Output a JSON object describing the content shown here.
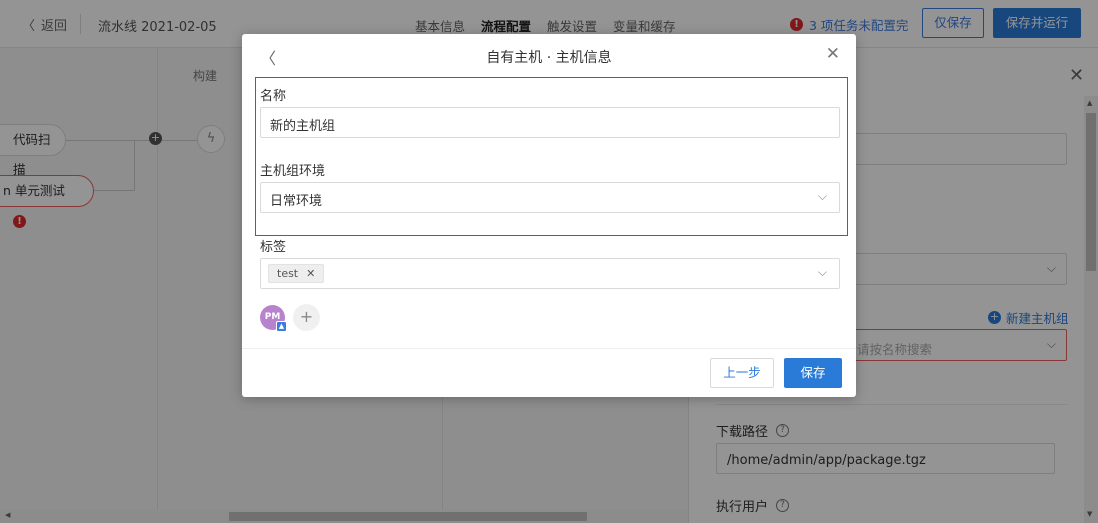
{
  "header": {
    "back_label": "返回",
    "pipeline_title": "流水线 2021-02-05",
    "tabs": [
      "基本信息",
      "流程配置",
      "触发设置",
      "变量和缓存"
    ],
    "warning_text": "3 项任务未配置完",
    "save_only_label": "仅保存",
    "save_run_label": "保存并运行"
  },
  "canvas": {
    "column_label": "构建",
    "nodes": [
      "代码扫描",
      "n 单元测试"
    ]
  },
  "drawer": {
    "new_group_label": "新建主机组",
    "search_placeholder": "请按名称搜索",
    "download_path_label": "下载路径",
    "download_path_value": "/home/admin/app/package.tgz",
    "exec_user_label": "执行用户"
  },
  "modal": {
    "title": "自有主机 · 主机信息",
    "name_label": "名称",
    "name_value": "新的主机组",
    "env_label": "主机组环境",
    "env_value": "日常环境",
    "tags_label": "标签",
    "tag_value": "test",
    "avatar_initials": "PM",
    "prev_label": "上一步",
    "save_label": "保存"
  },
  "colors": {
    "primary": "#2a7bd8",
    "error": "#e0282e",
    "avatar": "#b783cc"
  }
}
